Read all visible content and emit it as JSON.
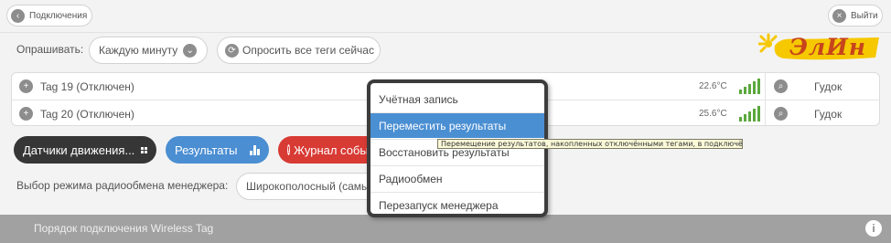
{
  "header": {
    "left_button_label": "Подключения",
    "right_button_label": "Выйти"
  },
  "logo": {
    "text": "ЭлИн"
  },
  "polling": {
    "label": "Опрашивать:",
    "interval_value": "Каждую минуту",
    "poll_all_label": "Опросить все теги сейчас"
  },
  "tags": [
    {
      "name": "Tag 19 (Отключен)",
      "temp": "22.6°C",
      "beep_label": "Гудок"
    },
    {
      "name": "Tag 20 (Отключен)",
      "temp": "25.6°C",
      "beep_label": "Гудок"
    }
  ],
  "actions": {
    "motion_label": "Датчики движения...",
    "results_label": "Результаты",
    "log_label": "Журнал собы"
  },
  "radio": {
    "label": "Выбор режима радиообмена менеджера:",
    "value": "Широкополосный (самы"
  },
  "menu": {
    "items": [
      {
        "label": "Учётная запись"
      },
      {
        "label": "Переместить результаты"
      },
      {
        "label": "Восстановить результаты"
      },
      {
        "label": "Радиообмен"
      },
      {
        "label": "Перезапуск менеджера"
      }
    ],
    "active_index": 1
  },
  "tooltip": {
    "text": "Перемещение результатов, накопленных отключёнными тегами, в подключённый тег"
  },
  "footer": {
    "text": "Порядок подключения Wireless Tag"
  },
  "colors": {
    "motion_button": "#363636",
    "results_button": "#4b8ed2",
    "log_button": "#d83a34",
    "menu_highlight": "#4b8fd3",
    "signal": "#5aa83c",
    "footer": "#a1a1a1",
    "logo_yellow": "#f6c800",
    "logo_ink": "#c7441c"
  },
  "icons": {
    "header_left": "chevron-left-icon",
    "header_right": "close-icon",
    "interval_dropdown": "chevron-down-icon",
    "poll_all": "refresh-icon",
    "tag_expand": "plus-icon",
    "tag_options": "search-icon",
    "motion": "grid-icon",
    "results": "bar-chart-icon",
    "log": "warning-icon",
    "footer": "info-icon"
  }
}
